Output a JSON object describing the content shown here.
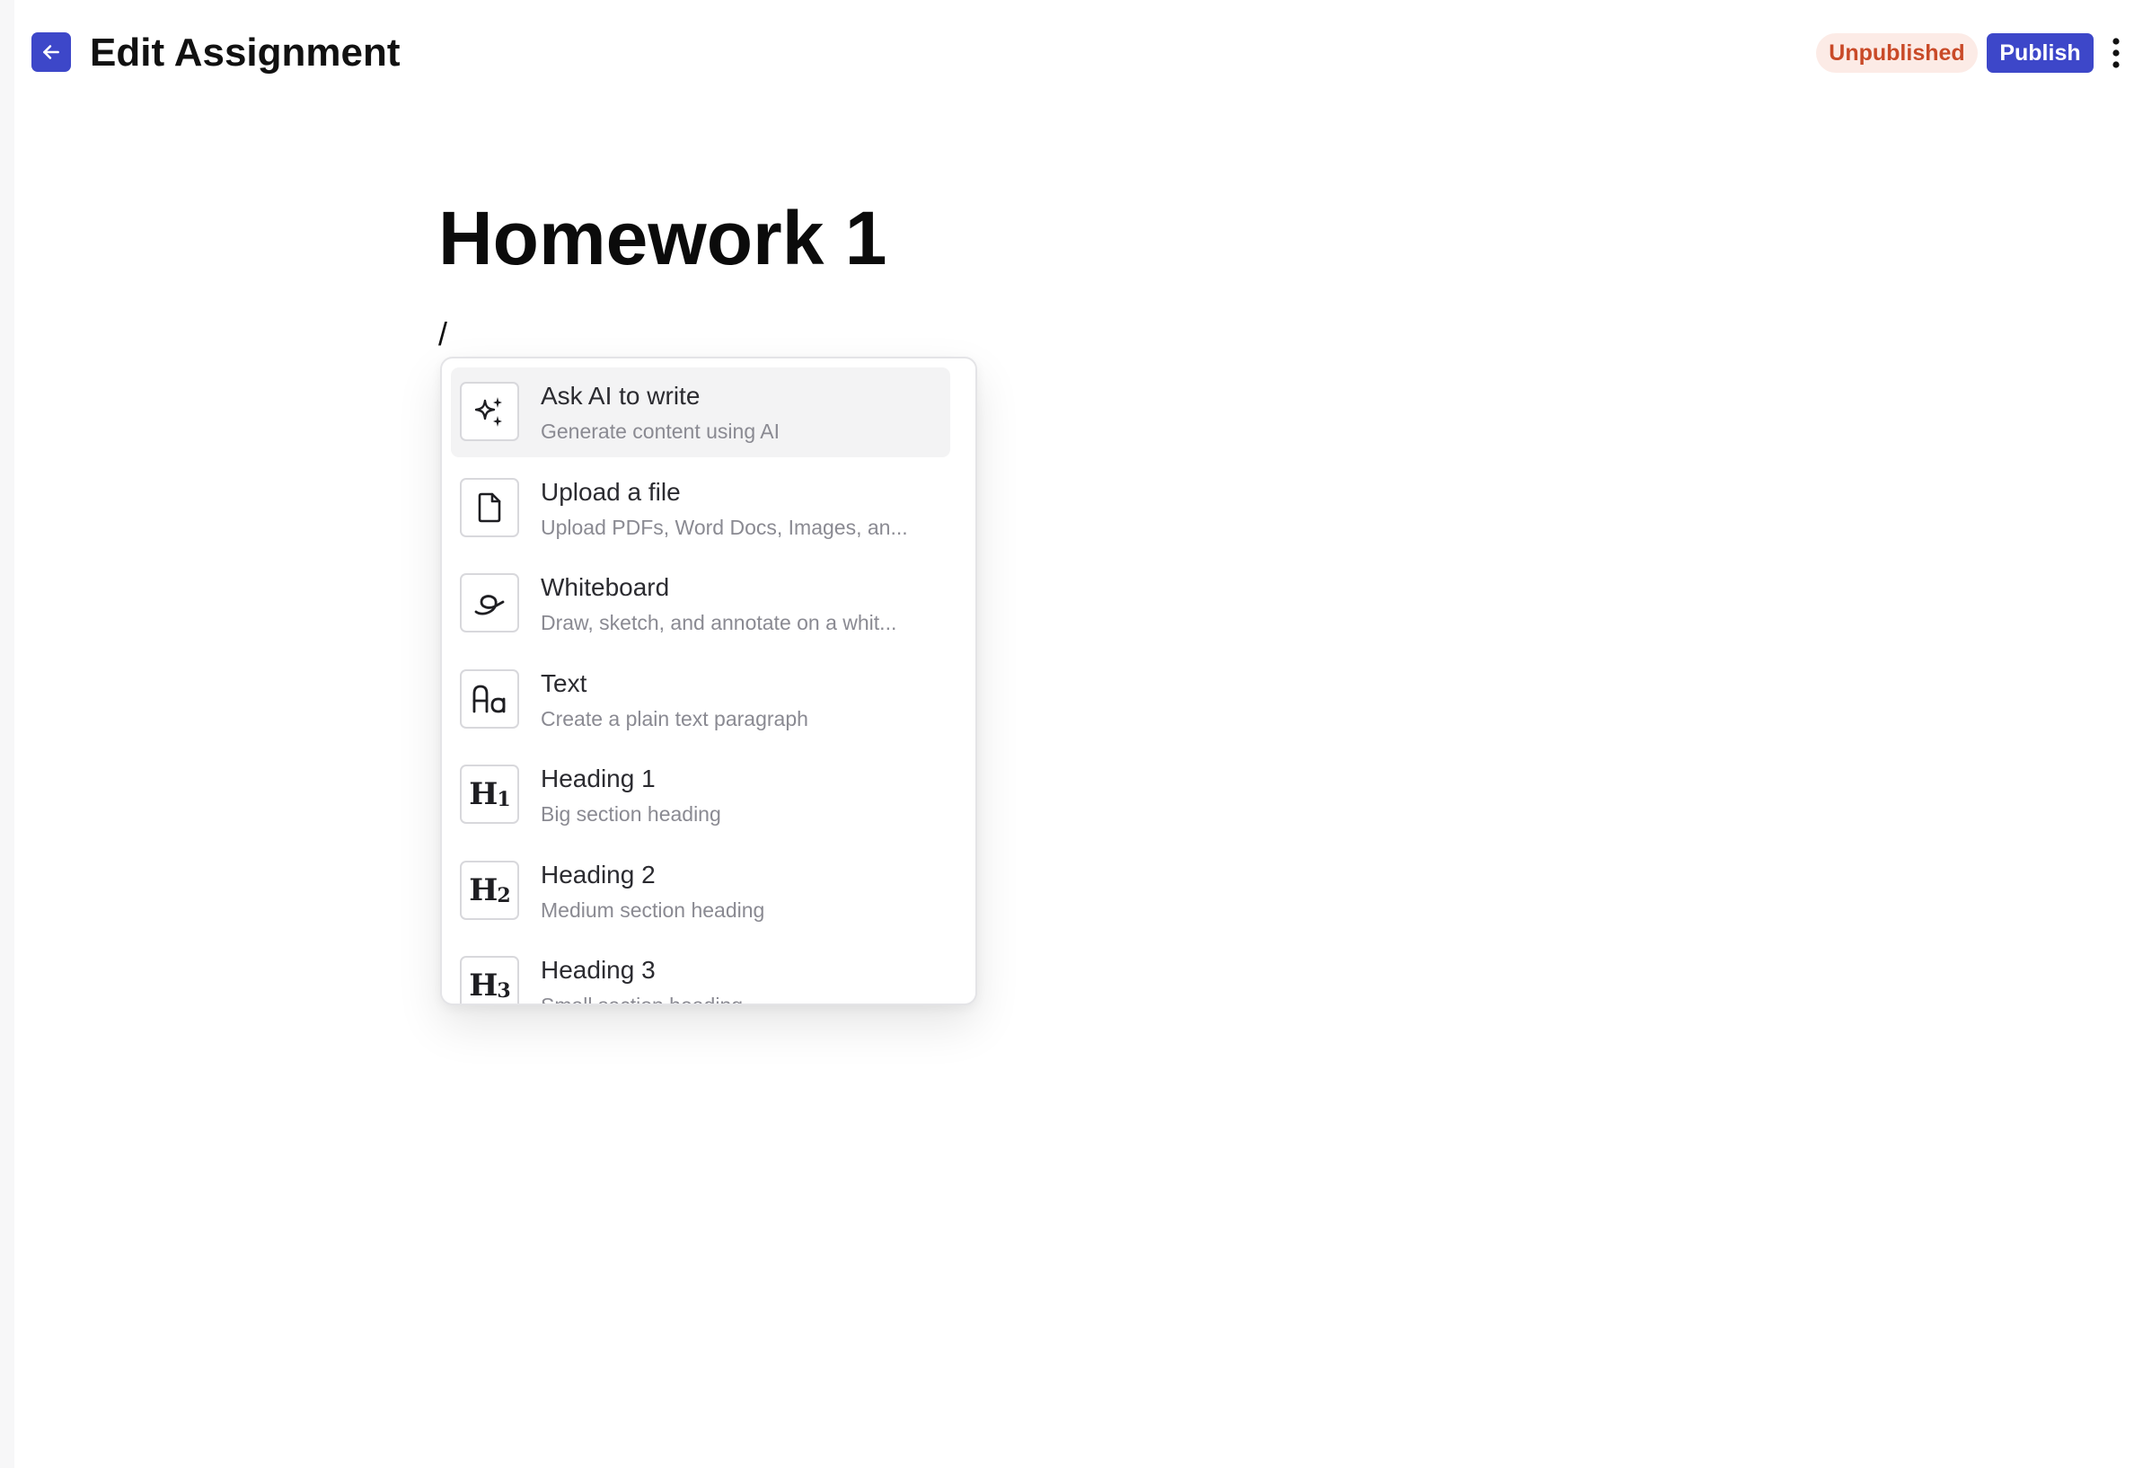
{
  "header": {
    "back_icon": "arrow-left-icon",
    "title": "Edit Assignment",
    "status_badge": "Unpublished",
    "publish_label": "Publish",
    "more_icon": "vertical-ellipsis-icon"
  },
  "colors": {
    "accent": "#3d47c9",
    "badge_text": "#c94a28",
    "badge_bg": "#fcebe6"
  },
  "document": {
    "title": "Homework 1",
    "current_line": "/"
  },
  "slash_menu": {
    "items": [
      {
        "icon": "sparkles-icon",
        "title": "Ask AI to write",
        "description": "Generate content using AI",
        "highlighted": true
      },
      {
        "icon": "file-icon",
        "title": "Upload a file",
        "description": "Upload PDFs, Word Docs, Images, an..."
      },
      {
        "icon": "whiteboard-icon",
        "title": "Whiteboard",
        "description": "Draw, sketch, and annotate on a whit..."
      },
      {
        "icon": "text-aa-icon",
        "title": "Text",
        "description": "Create a plain text paragraph"
      },
      {
        "icon": "heading-1-icon",
        "title": "Heading 1",
        "description": "Big section heading",
        "glyph": "H",
        "glyph_num": "1"
      },
      {
        "icon": "heading-2-icon",
        "title": "Heading 2",
        "description": "Medium section heading",
        "glyph": "H",
        "glyph_num": "2"
      },
      {
        "icon": "heading-3-icon",
        "title": "Heading 3",
        "description": "Small section heading",
        "glyph": "H",
        "glyph_num": "3"
      }
    ]
  }
}
